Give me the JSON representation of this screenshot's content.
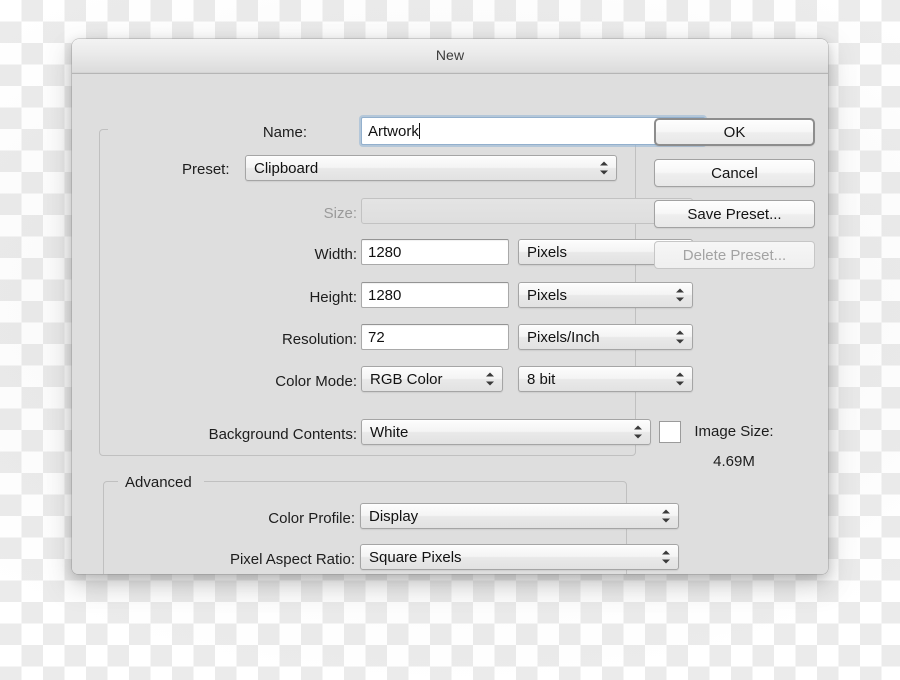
{
  "window": {
    "title": "New"
  },
  "form": {
    "name": {
      "label": "Name:",
      "value": "Artwork"
    },
    "preset": {
      "label": "Preset:",
      "value": "Clipboard"
    },
    "size": {
      "label": "Size:",
      "value": ""
    },
    "width": {
      "label": "Width:",
      "value": "1280",
      "unit": "Pixels"
    },
    "height": {
      "label": "Height:",
      "value": "1280",
      "unit": "Pixels"
    },
    "resolution": {
      "label": "Resolution:",
      "value": "72",
      "unit": "Pixels/Inch"
    },
    "color_mode": {
      "label": "Color Mode:",
      "value": "RGB Color",
      "depth": "8 bit"
    },
    "background_contents": {
      "label": "Background Contents:",
      "value": "White",
      "swatch_color": "#ffffff"
    }
  },
  "advanced": {
    "legend": "Advanced",
    "color_profile": {
      "label": "Color Profile:",
      "value": "Display"
    },
    "pixel_aspect_ratio": {
      "label": "Pixel Aspect Ratio:",
      "value": "Square Pixels"
    }
  },
  "buttons": {
    "ok": "OK",
    "cancel": "Cancel",
    "save_preset": "Save Preset...",
    "delete_preset": "Delete Preset..."
  },
  "image_size": {
    "label": "Image Size:",
    "value": "4.69M"
  },
  "colors": {
    "dialog_bg": "#dedede",
    "titlebar_top": "#f3f3f3",
    "titlebar_bottom": "#cfcfcf",
    "focus_ring": "#93b0cd",
    "text": "#1d1d1d",
    "disabled_text": "#9a9a9a"
  }
}
